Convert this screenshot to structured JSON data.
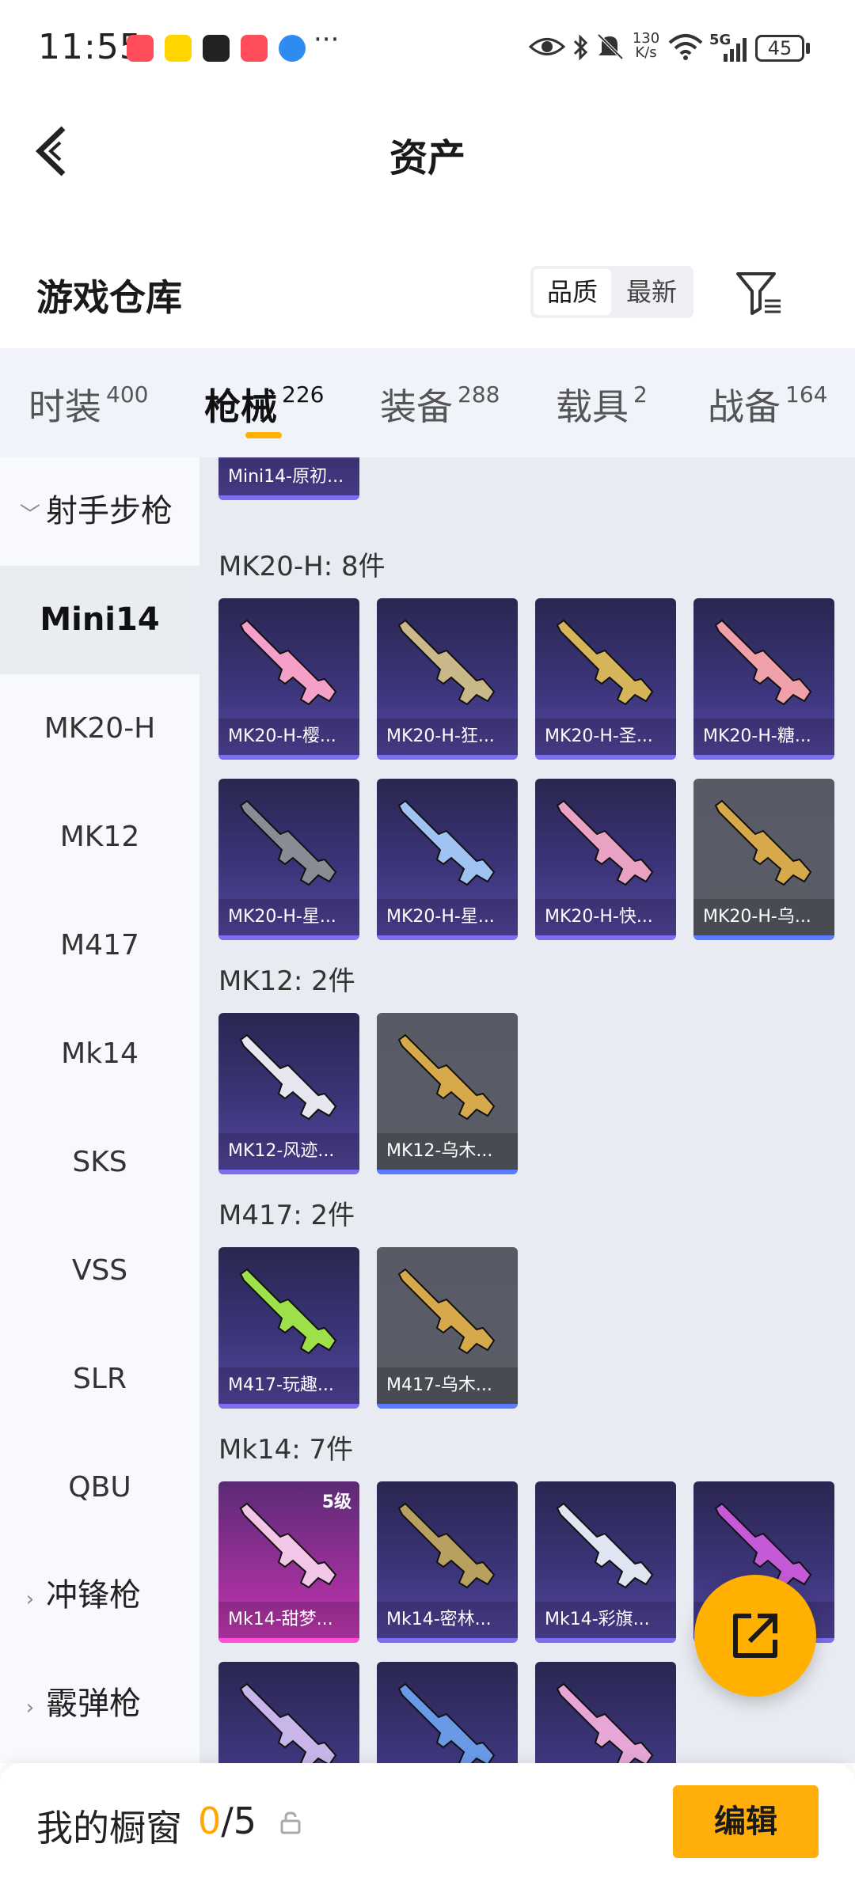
{
  "status_bar": {
    "time": "11:55",
    "more": "···",
    "net_speed_value": "130",
    "net_speed_unit": "K/s",
    "signal": "5G",
    "battery": "45"
  },
  "header": {
    "title": "资产"
  },
  "warehouse": {
    "title": "游戏仓库",
    "sort_options": [
      "品质",
      "最新"
    ],
    "sort_selected": "品质"
  },
  "tabs": [
    {
      "label": "时装",
      "count": "400"
    },
    {
      "label": "枪械",
      "count": "226",
      "active": true
    },
    {
      "label": "装备",
      "count": "288"
    },
    {
      "label": "载具",
      "count": "2"
    },
    {
      "label": "战备",
      "count": "164"
    }
  ],
  "sidebar": {
    "category_open": "射手步枪",
    "items": [
      "Mini14",
      "MK20-H",
      "MK12",
      "M417",
      "Mk14",
      "SKS",
      "VSS",
      "SLR",
      "QBU"
    ],
    "active_item": "Mini14",
    "collapsed_categories": [
      "冲锋枪",
      "霰弹枪"
    ]
  },
  "content": {
    "top_partial_card": "Mini14-原初...",
    "groups": [
      {
        "title": "MK20-H: 8件",
        "items": [
          {
            "label": "MK20-H-樱...",
            "style": "purple",
            "color": "#f4a0c8"
          },
          {
            "label": "MK20-H-狂...",
            "style": "purple",
            "color": "#c9b88a"
          },
          {
            "label": "MK20-H-圣...",
            "style": "purple",
            "color": "#d6b45a"
          },
          {
            "label": "MK20-H-糖...",
            "style": "purple",
            "color": "#f0a0a8"
          },
          {
            "label": "MK20-H-星...",
            "style": "purple",
            "color": "#8a8c95"
          },
          {
            "label": "MK20-H-星...",
            "style": "purple",
            "color": "#9ec2f2"
          },
          {
            "label": "MK20-H-快...",
            "style": "purple",
            "color": "#e9a2c4"
          },
          {
            "label": "MK20-H-乌...",
            "style": "gray",
            "color": "#d6a94a"
          }
        ]
      },
      {
        "title": "MK12: 2件",
        "items": [
          {
            "label": "MK12-风迹...",
            "style": "purple",
            "color": "#e6e6f0"
          },
          {
            "label": "MK12-乌木...",
            "style": "gray",
            "color": "#d6a94a"
          }
        ]
      },
      {
        "title": "M417: 2件",
        "items": [
          {
            "label": "M417-玩趣...",
            "style": "purple",
            "color": "#9ee04a"
          },
          {
            "label": "M417-乌木...",
            "style": "gray",
            "color": "#d6a94a"
          }
        ]
      },
      {
        "title": "Mk14: 7件",
        "items": [
          {
            "label": "Mk14-甜梦...",
            "style": "pink",
            "color": "#f2c6e6",
            "level": "5级"
          },
          {
            "label": "Mk14-密林...",
            "style": "purple",
            "color": "#b8a060"
          },
          {
            "label": "Mk14-彩旗...",
            "style": "purple",
            "color": "#dfe6f2"
          },
          {
            "label": "",
            "style": "purple",
            "color": "#c45ad6"
          },
          {
            "label": "",
            "style": "purple",
            "color": "#c8b6ea"
          },
          {
            "label": "",
            "style": "purple",
            "color": "#6a9ae6"
          },
          {
            "label": "",
            "style": "purple",
            "color": "#e6a6d6"
          }
        ]
      }
    ]
  },
  "bottom_bar": {
    "label": "我的橱窗",
    "current": "0",
    "total": "/5",
    "edit_label": "编辑"
  },
  "colors": {
    "accent": "#ffb000",
    "card_purple": "#3b3478",
    "card_gray": "#5a5c66"
  }
}
